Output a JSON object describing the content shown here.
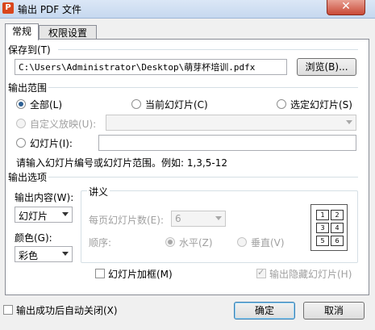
{
  "window": {
    "title": "输出 PDF 文件",
    "app_icon": "wps-icon",
    "close_label": "✕"
  },
  "tabs": [
    {
      "label": "常规"
    },
    {
      "label": "权限设置"
    }
  ],
  "save_to": {
    "label": "保存到(T)",
    "path": "C:\\Users\\Administrator\\Desktop\\萌芽杯培训.pdfx",
    "browse_label": "浏览(B)..."
  },
  "range": {
    "label": "输出范围",
    "all_label": "全部(L)",
    "current_label": "当前幻灯片(C)",
    "selected_label": "选定幻灯片(S)",
    "custom_label": "自定义放映(U):",
    "slides_label": "幻灯片(I):",
    "slides_value": "",
    "hint": "请输入幻灯片编号或幻灯片范围。例如: 1,3,5-12"
  },
  "options": {
    "label": "输出选项",
    "content_label": "输出内容(W):",
    "content_value": "幻灯片",
    "color_label": "颜色(G):",
    "color_value": "彩色",
    "handout": {
      "label": "讲义",
      "per_page_label": "每页幻灯片数(E):",
      "per_page_value": "6",
      "order_label": "顺序:",
      "horizontal_label": "水平(Z)",
      "vertical_label": "垂直(V)",
      "layout_cells": [
        "1",
        "2",
        "3",
        "4",
        "5",
        "6"
      ]
    },
    "frame_label": "幻灯片加框(M)",
    "hidden_label": "输出隐藏幻灯片(H)"
  },
  "footer": {
    "auto_close_label": "输出成功后自动关闭(X)",
    "ok_label": "确定",
    "cancel_label": "取消"
  }
}
